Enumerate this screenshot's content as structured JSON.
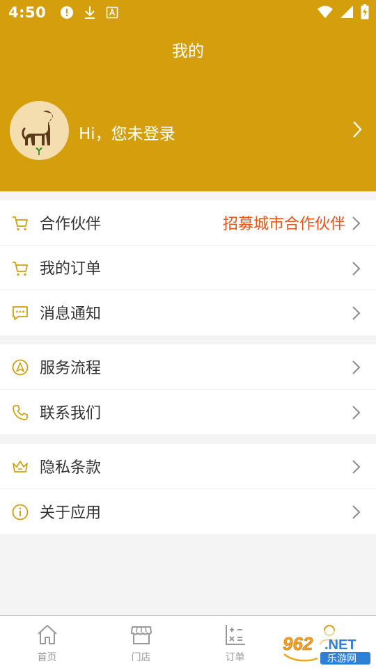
{
  "status_bar": {
    "time": "4:50",
    "left_icons": [
      "alert-icon",
      "download-icon",
      "a-box-icon"
    ],
    "right_icons": [
      "wifi-icon",
      "cell-signal-icon",
      "battery-charging-icon"
    ]
  },
  "header": {
    "title": "我的",
    "login_text": "Hi，您未登录",
    "background": "#d49e0c"
  },
  "menu": {
    "group1": [
      {
        "label": "合作伙伴",
        "extra": "招募城市合作伙伴",
        "icon": "cart-icon"
      },
      {
        "label": "我的订单",
        "extra": "",
        "icon": "cart-icon"
      },
      {
        "label": "消息通知",
        "extra": "",
        "icon": "message-icon"
      }
    ],
    "group2": [
      {
        "label": "服务流程",
        "icon": "navigation-icon"
      },
      {
        "label": "联系我们",
        "icon": "phone-icon"
      }
    ],
    "group3": [
      {
        "label": "隐私条款",
        "icon": "crown-icon"
      },
      {
        "label": "关于应用",
        "icon": "info-icon"
      }
    ],
    "accent_color": "#d49e0c",
    "extra_color": "#ea5418"
  },
  "tabs": [
    {
      "label": "首页",
      "icon": "home-icon"
    },
    {
      "label": "门店",
      "icon": "store-icon"
    },
    {
      "label": "订单",
      "icon": "calculator-icon"
    },
    {
      "label": "",
      "icon": "user-icon"
    }
  ],
  "watermark": {
    "brand": "962.NET",
    "sub": "乐游网"
  }
}
